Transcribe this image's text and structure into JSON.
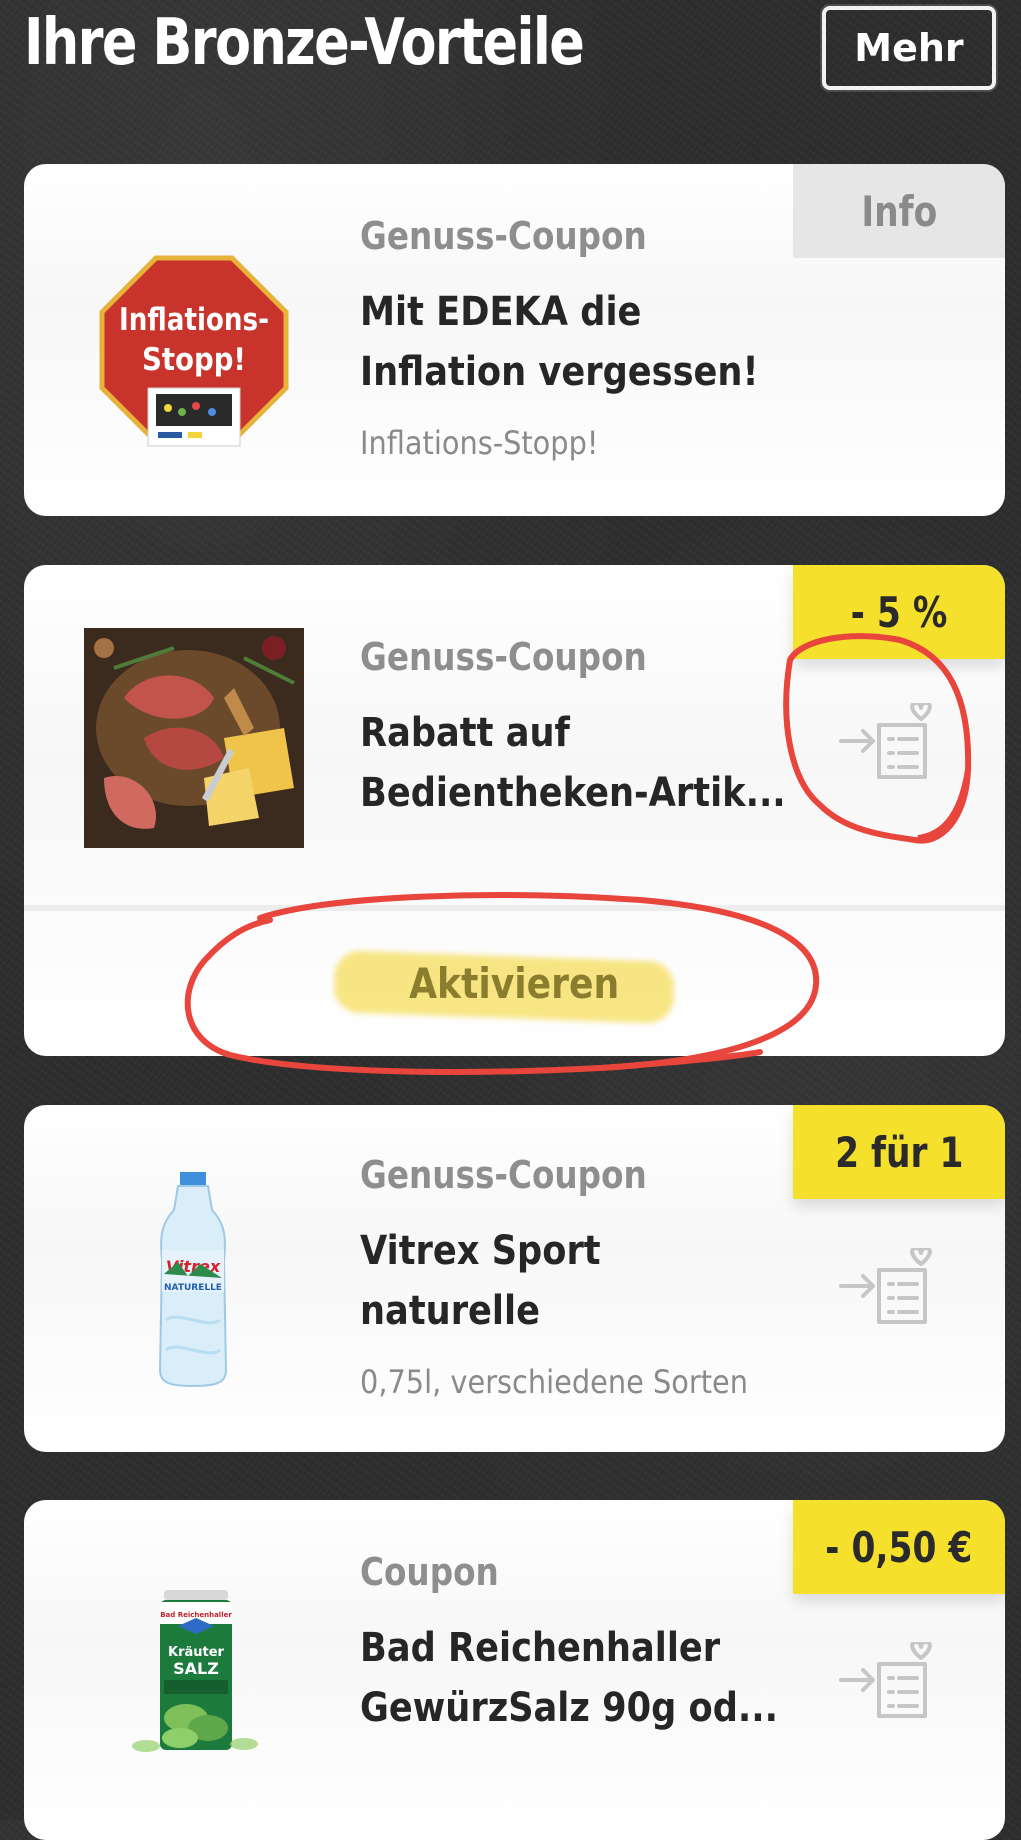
{
  "header": {
    "title": "Ihre Bronze-Vorteile",
    "more_label": "Mehr"
  },
  "coupons": [
    {
      "category": "Genuss-Coupon",
      "title_line1": "Mit EDEKA die",
      "title_line2": "Inflation vergessen!",
      "subtitle": "Inflations-Stopp!",
      "badge": "Info",
      "image_label_line1": "Inflations-",
      "image_label_line2": "Stopp!"
    },
    {
      "category": "Genuss-Coupon",
      "title_line1": "Rabatt auf",
      "title_line2": "Bedientheken-Artik...",
      "badge": "- 5 %",
      "action_label": "Aktivieren"
    },
    {
      "category": "Genuss-Coupon",
      "title_line1": "Vitrex Sport",
      "title_line2": "naturelle",
      "subtitle": "0,75l, verschiedene Sorten",
      "badge": "2 für 1",
      "product_brand": "Vitrex",
      "product_variant": "NATURELLE"
    },
    {
      "category": "Coupon",
      "title_line1": "Bad Reichenhaller",
      "title_line2": "GewürzSalz 90g od...",
      "badge": "- 0,50 €",
      "product_brand": "Bad Reichenhaller",
      "product_variant_line1": "Kräuter",
      "product_variant_line2": "SALZ"
    }
  ],
  "colors": {
    "badge_yellow": "#f5e12c",
    "badge_grey": "#e6e6e6",
    "annotation_red": "#e8453c",
    "background": "#2e2e2e"
  },
  "icons": [
    "add-to-list-icon"
  ]
}
